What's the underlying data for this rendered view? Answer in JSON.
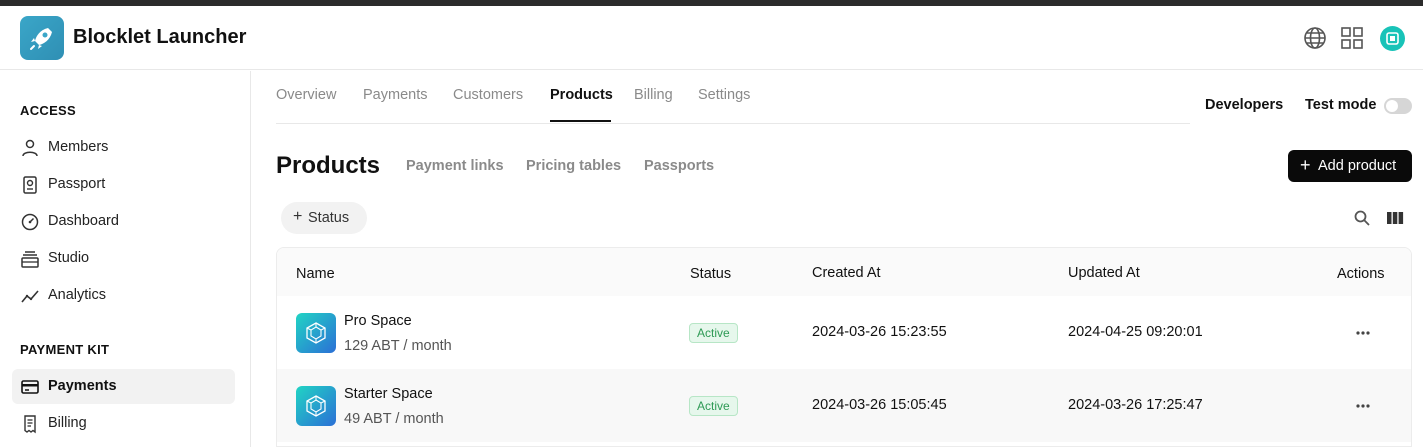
{
  "app": {
    "title": "Blocklet Launcher"
  },
  "header": {
    "icons": [
      "globe-icon",
      "apps-grid-icon",
      "avatar"
    ]
  },
  "sidebar": {
    "sections": [
      {
        "title": "ACCESS",
        "items": [
          {
            "label": "Members",
            "icon": "user-icon"
          },
          {
            "label": "Passport",
            "icon": "passport-icon"
          },
          {
            "label": "Dashboard",
            "icon": "gauge-icon"
          },
          {
            "label": "Studio",
            "icon": "studio-icon"
          },
          {
            "label": "Analytics",
            "icon": "analytics-icon"
          }
        ]
      },
      {
        "title": "PAYMENT KIT",
        "items": [
          {
            "label": "Payments",
            "icon": "credit-card-icon",
            "active": true
          },
          {
            "label": "Billing",
            "icon": "receipt-icon"
          }
        ]
      }
    ]
  },
  "tabs": [
    "Overview",
    "Payments",
    "Customers",
    "Products",
    "Billing",
    "Settings"
  ],
  "active_tab": "Products",
  "top_right": {
    "developers": "Developers",
    "test_mode": "Test mode",
    "test_mode_on": false
  },
  "page": {
    "title": "Products",
    "subtabs": [
      "Payment links",
      "Pricing tables",
      "Passports"
    ],
    "add_button": "Add product",
    "filter": "Status"
  },
  "table": {
    "columns": [
      "Name",
      "Status",
      "Created At",
      "Updated At",
      "Actions"
    ],
    "rows": [
      {
        "name": "Pro Space",
        "price": "129 ABT / month",
        "status": "Active",
        "created": "2024-03-26 15:23:55",
        "updated": "2024-04-25 09:20:01"
      },
      {
        "name": "Starter Space",
        "price": "49 ABT / month",
        "status": "Active",
        "created": "2024-03-26 15:05:45",
        "updated": "2024-03-26 17:25:47"
      }
    ]
  },
  "colors": {
    "accent": "#0a0a0a",
    "active_badge": "#2e9a55",
    "logo": "#3aa6c8"
  }
}
